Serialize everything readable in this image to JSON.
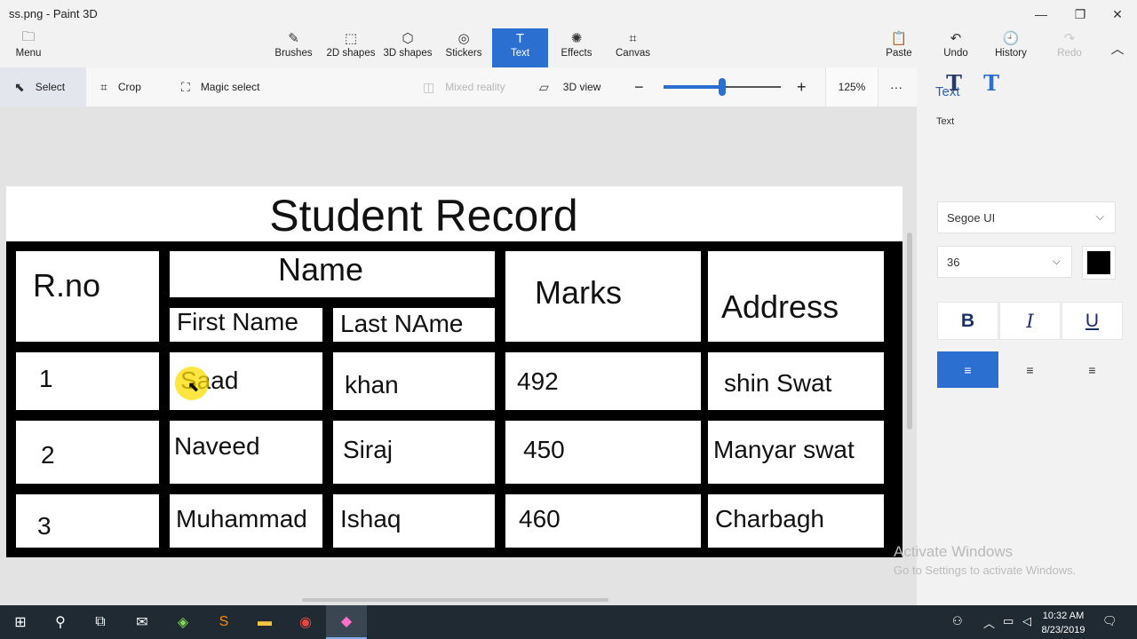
{
  "window": {
    "title": "ss.png - Paint 3D"
  },
  "ribbon": {
    "menu": "Menu",
    "items": [
      {
        "label": "Brushes",
        "icon": "brush-icon",
        "glyph": "✎"
      },
      {
        "label": "2D shapes",
        "icon": "2d-shapes-icon",
        "glyph": "⬚"
      },
      {
        "label": "3D shapes",
        "icon": "3d-shapes-icon",
        "glyph": "⬡"
      },
      {
        "label": "Stickers",
        "icon": "stickers-icon",
        "glyph": "◎"
      },
      {
        "label": "Text",
        "icon": "text-icon",
        "glyph": "T"
      },
      {
        "label": "Effects",
        "icon": "effects-icon",
        "glyph": "✺"
      },
      {
        "label": "Canvas",
        "icon": "canvas-icon",
        "glyph": "⌗"
      }
    ],
    "active": "Text",
    "right": [
      {
        "label": "Paste",
        "icon": "paste-icon",
        "glyph": "📋"
      },
      {
        "label": "Undo",
        "icon": "undo-icon",
        "glyph": "↶"
      },
      {
        "label": "History",
        "icon": "history-icon",
        "glyph": "🕘"
      },
      {
        "label": "Redo",
        "icon": "redo-icon",
        "glyph": "↷"
      }
    ]
  },
  "toolbar": {
    "select": "Select",
    "crop": "Crop",
    "magic_select": "Magic select",
    "mixed_reality": "Mixed reality",
    "view_3d": "3D view",
    "zoom": "125%",
    "zoom_fraction": 0.5,
    "more": "···"
  },
  "canvas": {
    "title": "Student Record",
    "headers": {
      "rno": "R.no",
      "name": "Name",
      "first": "First Name",
      "last": "Last NAme",
      "marks": "Marks",
      "address": "Address"
    },
    "rows": [
      {
        "rno": "1",
        "first": "Saad",
        "last": "khan",
        "marks": "492",
        "address": "shin Swat"
      },
      {
        "rno": "2",
        "first": "Naveed",
        "last": "Siraj",
        "marks": "450",
        "address": "Manyar swat"
      },
      {
        "rno": "3",
        "first": "Muhammad",
        "last": "Ishaq",
        "marks": "460",
        "address": "Charbagh"
      }
    ]
  },
  "panel": {
    "title": "Text",
    "section": "Text",
    "font": "Segoe UI",
    "size": "36",
    "color": "#000000",
    "bold": "B",
    "italic": "I",
    "underline": "U"
  },
  "watermark": {
    "line1": "Activate Windows",
    "line2": "Go to Settings to activate Windows."
  },
  "taskbar": {
    "time": "10:32 AM",
    "date": "8/23/2019"
  }
}
